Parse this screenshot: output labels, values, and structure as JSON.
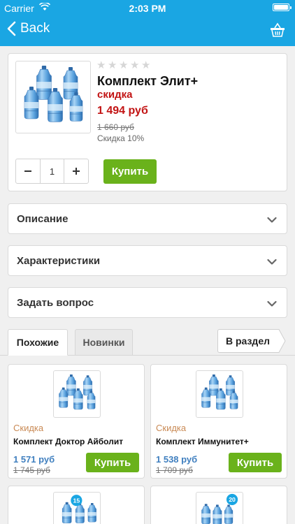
{
  "status_bar": {
    "carrier": "Carrier",
    "time": "2:03 PM"
  },
  "nav": {
    "back_label": "Back",
    "basket_icon": "basket-icon"
  },
  "product": {
    "title": "Комплект Элит+",
    "tag": "скидка",
    "price": "1 494 руб",
    "old_price": "1 660 руб",
    "discount": "Скидка 10%",
    "rating": 0,
    "quantity": "1",
    "buy_label": "Купить"
  },
  "accordions": {
    "description": "Описание",
    "specs": "Характеристики",
    "question": "Задать вопрос"
  },
  "tabs": {
    "similar": "Похожие",
    "new": "Новинки",
    "section_button": "В раздел"
  },
  "related": [
    {
      "tag": "Скидка",
      "name": "Комплект Доктор Айболит",
      "price": "1 571 руб",
      "old_price": "1 745 руб",
      "buy_label": "Купить"
    },
    {
      "tag": "Скидка",
      "name": "Комплект Иммунитет+",
      "price": "1 538 руб",
      "old_price": "1 709 руб",
      "buy_label": "Купить"
    }
  ],
  "related_more": [
    {
      "badge": "15"
    },
    {
      "badge": "20"
    }
  ],
  "colors": {
    "accent": "#1aa6e3",
    "buy": "#6ab21b",
    "price_red": "#c21313",
    "price_blue": "#3f7fbf",
    "tag_orange": "#c98a55"
  }
}
